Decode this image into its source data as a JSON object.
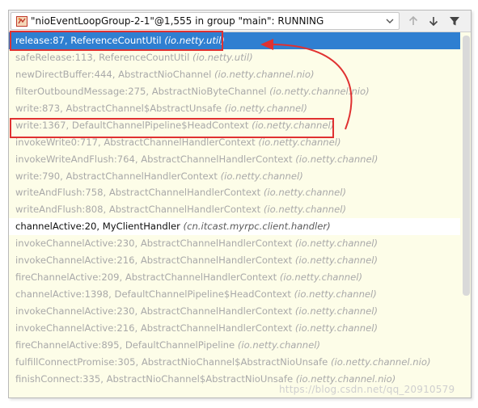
{
  "thread_selector": {
    "label": "\"nioEventLoopGroup-2-1\"@1,555 in group \"main\": RUNNING"
  },
  "toolbar": {
    "up_icon": "arrow-up-icon",
    "down_icon": "arrow-down-icon",
    "filter_icon": "filter-icon"
  },
  "frames": [
    {
      "method": "release:87, ReferenceCountUtil",
      "pkg": "(io.netty.util)",
      "state": "selected"
    },
    {
      "method": "safeRelease:113, ReferenceCountUtil",
      "pkg": "(io.netty.util)",
      "state": "library"
    },
    {
      "method": "newDirectBuffer:444, AbstractNioChannel",
      "pkg": "(io.netty.channel.nio)",
      "state": "library"
    },
    {
      "method": "filterOutboundMessage:275, AbstractNioByteChannel",
      "pkg": "(io.netty.channel.nio)",
      "state": "library"
    },
    {
      "method": "write:873, AbstractChannel$AbstractUnsafe",
      "pkg": "(io.netty.channel)",
      "state": "library"
    },
    {
      "method": "write:1367, DefaultChannelPipeline$HeadContext",
      "pkg": "(io.netty.channel)",
      "state": "library"
    },
    {
      "method": "invokeWrite0:717, AbstractChannelHandlerContext",
      "pkg": "(io.netty.channel)",
      "state": "library"
    },
    {
      "method": "invokeWriteAndFlush:764, AbstractChannelHandlerContext",
      "pkg": "(io.netty.channel)",
      "state": "library"
    },
    {
      "method": "write:790, AbstractChannelHandlerContext",
      "pkg": "(io.netty.channel)",
      "state": "library"
    },
    {
      "method": "writeAndFlush:758, AbstractChannelHandlerContext",
      "pkg": "(io.netty.channel)",
      "state": "library"
    },
    {
      "method": "writeAndFlush:808, AbstractChannelHandlerContext",
      "pkg": "(io.netty.channel)",
      "state": "library"
    },
    {
      "method": "channelActive:20, MyClientHandler",
      "pkg": "(cn.itcast.myrpc.client.handler)",
      "state": "normal"
    },
    {
      "method": "invokeChannelActive:230, AbstractChannelHandlerContext",
      "pkg": "(io.netty.channel)",
      "state": "library"
    },
    {
      "method": "invokeChannelActive:216, AbstractChannelHandlerContext",
      "pkg": "(io.netty.channel)",
      "state": "library"
    },
    {
      "method": "fireChannelActive:209, AbstractChannelHandlerContext",
      "pkg": "(io.netty.channel)",
      "state": "library"
    },
    {
      "method": "channelActive:1398, DefaultChannelPipeline$HeadContext",
      "pkg": "(io.netty.channel)",
      "state": "library"
    },
    {
      "method": "invokeChannelActive:230, AbstractChannelHandlerContext",
      "pkg": "(io.netty.channel)",
      "state": "library"
    },
    {
      "method": "invokeChannelActive:216, AbstractChannelHandlerContext",
      "pkg": "(io.netty.channel)",
      "state": "library"
    },
    {
      "method": "fireChannelActive:895, DefaultChannelPipeline",
      "pkg": "(io.netty.channel)",
      "state": "library"
    },
    {
      "method": "fulfillConnectPromise:305, AbstractNioChannel$AbstractNioUnsafe",
      "pkg": "(io.netty.channel.nio)",
      "state": "library"
    },
    {
      "method": "finishConnect:335, AbstractNioChannel$AbstractNioUnsafe",
      "pkg": "(io.netty.channel.nio)",
      "state": "library"
    }
  ],
  "watermark": "https://blog.csdn.net/qq_20910579",
  "colors": {
    "selected_row": "#2f7fd1",
    "library_background": "#fdfde8",
    "annotation_red": "#e03131"
  }
}
